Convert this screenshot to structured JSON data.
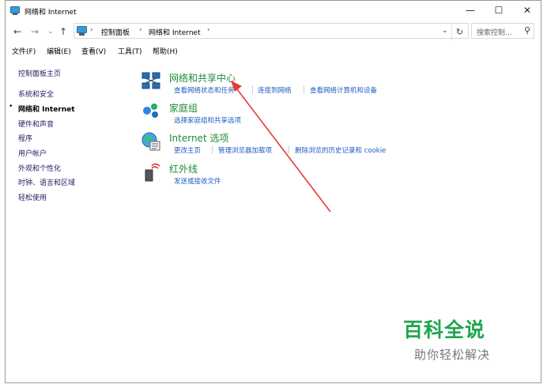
{
  "window": {
    "title": "网络和 Internet",
    "controls": {
      "minimize": "—",
      "maximize": "☐",
      "close": "✕"
    }
  },
  "nav": {
    "back": "←",
    "forward": "→",
    "recent": "⌄",
    "up": "↑"
  },
  "address": {
    "crumbs": [
      "控制面板",
      "网络和 Internet"
    ],
    "separator": "›",
    "dropdown": "⌄",
    "refresh": "↻"
  },
  "search": {
    "placeholder": "搜索控制...",
    "icon": "search-icon"
  },
  "menu": [
    "文件(F)",
    "编辑(E)",
    "查看(V)",
    "工具(T)",
    "帮助(H)"
  ],
  "sidebar": {
    "home": "控制面板主页",
    "items": [
      {
        "label": "系统和安全",
        "active": false
      },
      {
        "label": "网络和 Internet",
        "active": true
      },
      {
        "label": "硬件和声音",
        "active": false
      },
      {
        "label": "程序",
        "active": false
      },
      {
        "label": "用户帐户",
        "active": false
      },
      {
        "label": "外观和个性化",
        "active": false
      },
      {
        "label": "时钟、语言和区域",
        "active": false
      },
      {
        "label": "轻松使用",
        "active": false
      }
    ]
  },
  "categories": [
    {
      "title": "网络和共享中心",
      "icon": "network-sharing-icon",
      "links": [
        "查看网络状态和任务",
        "连接到网络",
        "查看网络计算机和设备"
      ]
    },
    {
      "title": "家庭组",
      "icon": "homegroup-icon",
      "links": [
        "选择家庭组和共享选项"
      ]
    },
    {
      "title": "Internet 选项",
      "icon": "internet-options-icon",
      "links": [
        "更改主页",
        "管理浏览器加载项",
        "删除浏览的历史记录和 cookie"
      ]
    },
    {
      "title": "红外线",
      "icon": "infrared-icon",
      "links": [
        "发送或接收文件"
      ]
    }
  ],
  "watermark": {
    "title": "百科全说",
    "subtitle": "助你轻松解决"
  },
  "colors": {
    "category_title": "#1f8a3b",
    "link": "#1f5dbf",
    "arrow": "#e53935",
    "watermark": "#1fa54f"
  }
}
